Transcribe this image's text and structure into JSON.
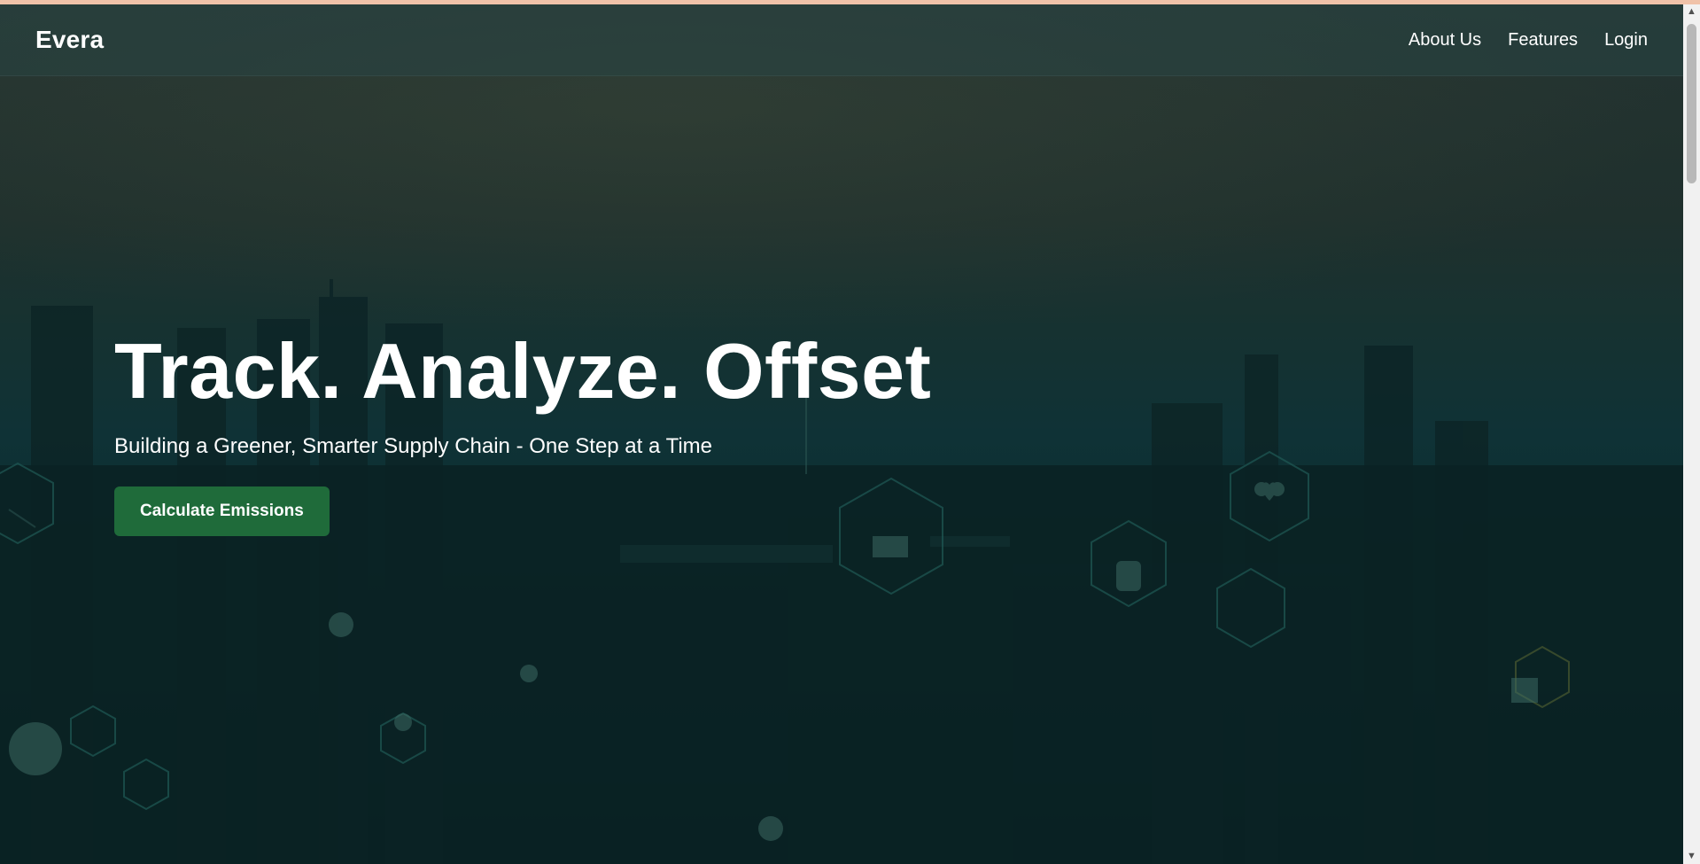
{
  "nav": {
    "brand": "Evera",
    "links": [
      {
        "label": "About Us"
      },
      {
        "label": "Features"
      },
      {
        "label": "Login"
      }
    ]
  },
  "hero": {
    "title": "Track. Analyze. Offset",
    "subtitle": "Building a Greener, Smarter Supply Chain - One Step at a Time",
    "cta_label": "Calculate Emissions"
  },
  "colors": {
    "accent": "#1f6b3a",
    "nav_bg": "#284646",
    "text": "#ffffff",
    "hero_bg": "#0f3236"
  },
  "background_icons": [
    "heart-icon",
    "solar-panel-icon",
    "document-icon",
    "water-drop-icon",
    "shield-icon",
    "recycle-icon",
    "tree-icon",
    "wind-turbine-icon",
    "leaf-icon"
  ]
}
